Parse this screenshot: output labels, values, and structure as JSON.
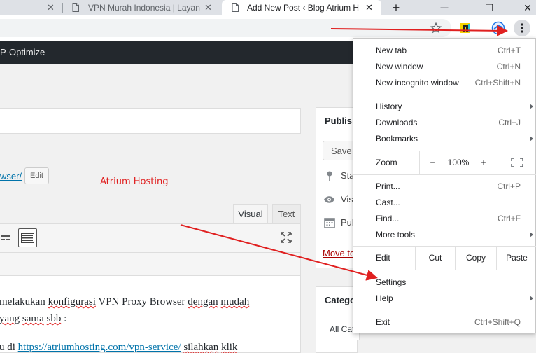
{
  "browser": {
    "tabs": [
      {
        "title": "",
        "close": "✕"
      },
      {
        "title": "VPN Murah Indonesia | Layana",
        "close": "✕"
      },
      {
        "title": "Add New Post ‹ Blog Atrium H",
        "close": "✕"
      }
    ],
    "new_tab": "+",
    "window": {
      "minimize": "—",
      "maximize": "☐",
      "close": "✕"
    },
    "toolbar": {
      "bookmark_icon": "star-icon",
      "menu_icon": "vertical-dots-icon"
    }
  },
  "adminbar": {
    "plugin": "P-Optimize"
  },
  "editor": {
    "permalink": "wser/",
    "edit_label": "Edit",
    "annotation": "Atrium Hosting",
    "tabs": {
      "visual": "Visual",
      "text": "Text"
    },
    "paragraphs": {
      "p1a": "melakukan ",
      "p1b": "konfigurasi",
      "p1c": " VPN Proxy Browser ",
      "p1d": "dengan",
      "p1e": " ",
      "p1f": "mudah",
      "p2a": "yang",
      "p2b": " ",
      "p2c": "sama",
      "p2d": " ",
      "p2e": "sbb",
      "p2f": " :",
      "p3a": "u di ",
      "p3link": "https://atriumhosting.com/vpn-service/",
      "p3b": " ",
      "p3c": "silahkan",
      "p3d": " ",
      "p3e": "klik"
    }
  },
  "publish": {
    "heading": "Publis",
    "save": "Save",
    "rows": [
      "Sta",
      "Visi",
      "Pul"
    ],
    "trash": "Move to"
  },
  "categories": {
    "heading": "Catego",
    "tab": "All Cat"
  },
  "menu": {
    "new_tab": {
      "label": "New tab",
      "shortcut": "Ctrl+T"
    },
    "new_window": {
      "label": "New window",
      "shortcut": "Ctrl+N"
    },
    "incognito": {
      "label": "New incognito window",
      "shortcut": "Ctrl+Shift+N"
    },
    "history": {
      "label": "History"
    },
    "downloads": {
      "label": "Downloads",
      "shortcut": "Ctrl+J"
    },
    "bookmarks": {
      "label": "Bookmarks"
    },
    "zoom": {
      "label": "Zoom",
      "minus": "−",
      "level": "100%",
      "plus": "+"
    },
    "print": {
      "label": "Print...",
      "shortcut": "Ctrl+P"
    },
    "cast": {
      "label": "Cast..."
    },
    "find": {
      "label": "Find...",
      "shortcut": "Ctrl+F"
    },
    "more_tools": {
      "label": "More tools"
    },
    "edit": {
      "label": "Edit",
      "cut": "Cut",
      "copy": "Copy",
      "paste": "Paste"
    },
    "settings": {
      "label": "Settings"
    },
    "help": {
      "label": "Help"
    },
    "exit": {
      "label": "Exit",
      "shortcut": "Ctrl+Shift+Q"
    }
  },
  "colors": {
    "annotation_red": "#e02020",
    "adminbar": "#23282d",
    "link": "#0073aa"
  }
}
